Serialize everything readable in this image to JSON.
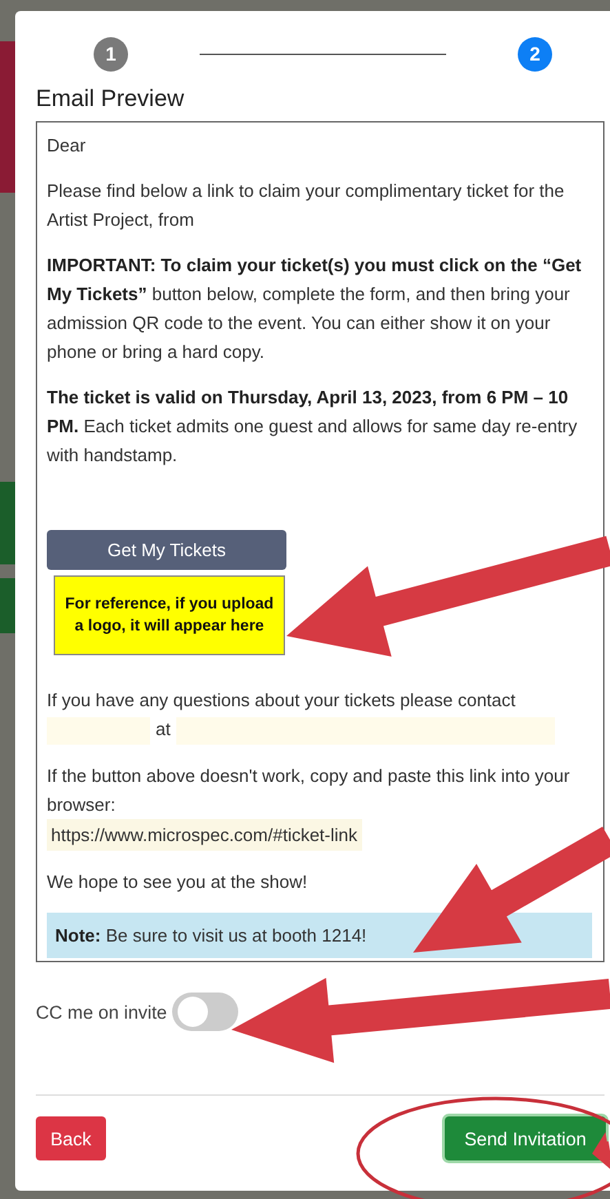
{
  "steps": [
    {
      "label": "1",
      "selected": false
    },
    {
      "label": "2",
      "selected": true
    }
  ],
  "title": "Email Preview",
  "email": [
    {
      "kind": "text",
      "text": "Dear"
    },
    {
      "kind": "text",
      "text": "Please find below a link to claim your complimentary ticket for the Artist Project, from"
    },
    {
      "kind": "text",
      "text": "**IMPORTANT: To claim your ticket(s) you must click on the “Get My Tickets”** button below, complete the form, and then bring your admission QR code to the event. You can either show it on your phone or bring a hard copy."
    },
    {
      "kind": "text",
      "text": "**The ticket is valid on Thursday, April 13, 2023, from 6 PM – 10 PM.** Each ticket admits one guest and allows for same day re-entry with handstamp."
    },
    {
      "kind": "button",
      "text": "Get My Tickets"
    },
    {
      "kind": "logo",
      "text": "For reference, if you upload a logo, it will appear here"
    },
    {
      "kind": "contact",
      "text": "If you have any questions about your tickets please contact",
      "joiner": "at"
    },
    {
      "kind": "link",
      "text": "If the button above doesn't work, copy and paste this link into your browser:",
      "url": "https://www.microspec.com/#ticket-link"
    },
    {
      "kind": "text",
      "text": "We hope to see you at the show!"
    },
    {
      "kind": "note",
      "text": "**Note:** Be sure to visit us at booth 1214!"
    }
  ],
  "cc": {
    "label": "CC me on invite",
    "on": false
  },
  "buttons": [
    {
      "kind": "back",
      "label": "Back"
    },
    {
      "kind": "send",
      "label": "Send Invitation"
    }
  ]
}
